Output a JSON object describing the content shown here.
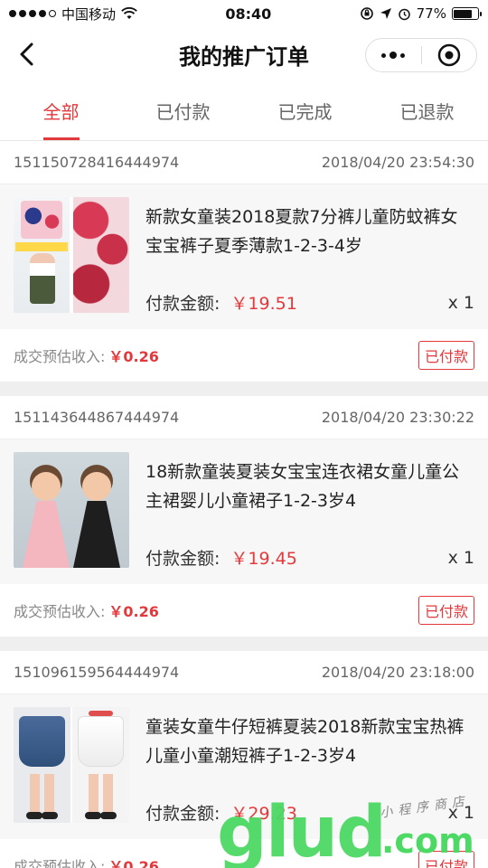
{
  "status_bar": {
    "carrier": "中国移动",
    "time": "08:40",
    "battery": "77%",
    "battery_level": 0.77
  },
  "nav": {
    "title": "我的推广订单"
  },
  "tabs": [
    {
      "label": "全部",
      "active": true
    },
    {
      "label": "已付款",
      "active": false
    },
    {
      "label": "已完成",
      "active": false
    },
    {
      "label": "已退款",
      "active": false
    }
  ],
  "orders": [
    {
      "order_id": "151150728416444974",
      "datetime": "2018/04/20 23:54:30",
      "title": "新款女童装2018夏款7分裤儿童防蚊裤女宝宝裤子夏季薄款1-2-3-4岁",
      "price_label": "付款金额:",
      "price": "￥19.51",
      "qty": "x 1",
      "income_label": "成交预估收入:",
      "income": "￥0.26",
      "status": "已付款"
    },
    {
      "order_id": "151143644867444974",
      "datetime": "2018/04/20 23:30:22",
      "title": "18新款童装夏装女宝宝连衣裙女童儿童公主裙婴儿小童裙子1-2-3岁4",
      "price_label": "付款金额:",
      "price": "￥19.45",
      "qty": "x 1",
      "income_label": "成交预估收入:",
      "income": "￥0.26",
      "status": "已付款"
    },
    {
      "order_id": "151096159564444974",
      "datetime": "2018/04/20 23:18:00",
      "title": "童装女童牛仔短裤夏装2018新款宝宝热裤儿童小童潮短裤子1-2-3岁4",
      "price_label": "付款金额:",
      "price": "￥29.23",
      "qty": "x 1",
      "income_label": "成交预估收入:",
      "income": "￥0.26",
      "status": "已付款"
    }
  ],
  "watermark": {
    "main": "glud",
    "suffix": ".com",
    "cn": "小程序商店"
  }
}
